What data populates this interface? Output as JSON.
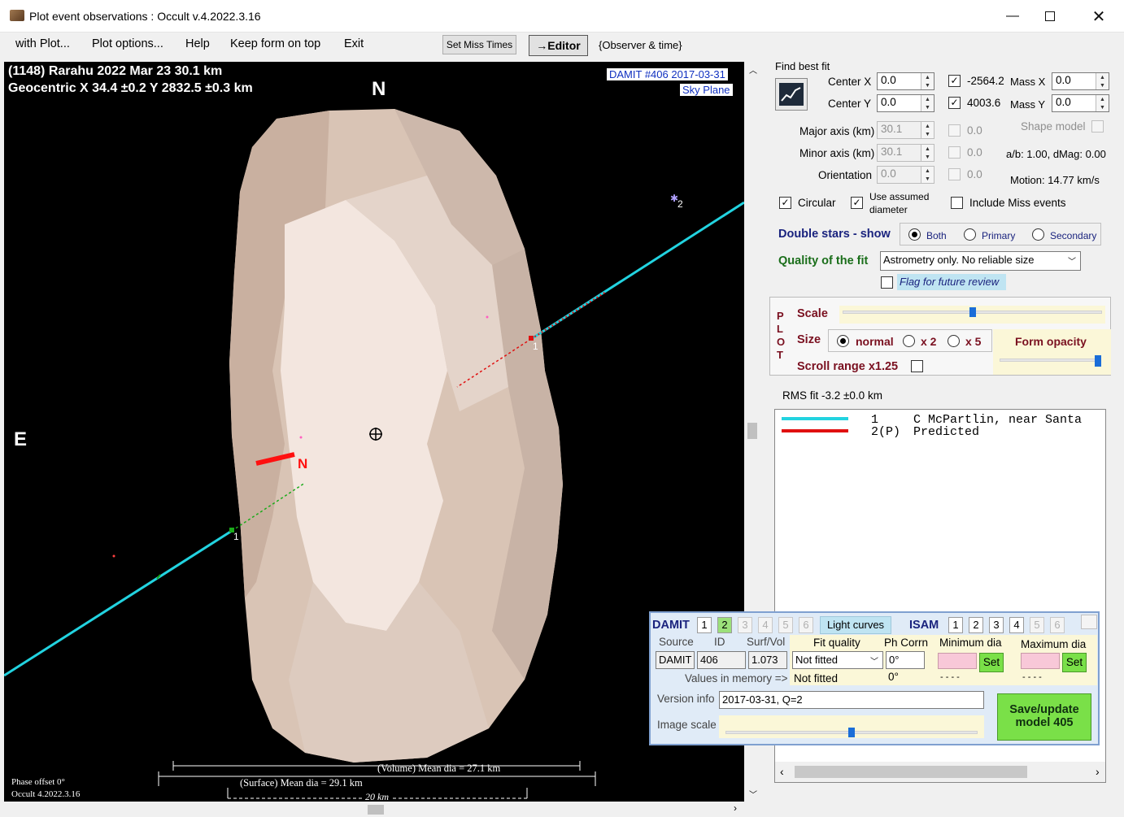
{
  "window": {
    "title": "Plot event observations : Occult v.4.2022.3.16"
  },
  "menu": {
    "items": [
      "with Plot...",
      "Plot options...",
      "Help",
      "Keep form on top",
      "Exit"
    ],
    "set_miss_times": "Set Miss Times",
    "editor": "→Editor",
    "observer_time": "{Observer & time}"
  },
  "plot": {
    "header_line1": "(1148) Rarahu  2022 Mar 23   30.1 km",
    "header_line2": "Geocentric  X  34.4 ±0.2  Y 2832.5 ±0.3 km",
    "north_label": "N",
    "east_label": "E",
    "damit_label": "DAMIT #406 2017-03-31",
    "sky_plane": "Sky Plane",
    "pole_label": "N",
    "chord1_label_a": "1",
    "chord1_label_b": "1",
    "chord2_label": "2",
    "volume_dia": "(Volume) Mean dia = 27.1 km",
    "surface_dia": "(Surface) Mean dia = 29.1 km",
    "scale_label": "20 km",
    "phase_offset": "Phase offset 0°",
    "version": "Occult 4.2022.3.16"
  },
  "fit": {
    "find_best_fit": "Find best fit",
    "center_x_label": "Center X",
    "center_x": "0.0",
    "center_y_label": "Center Y",
    "center_y": "0.0",
    "x_value": "-2564.2",
    "y_value": "4003.6",
    "mass_x_label": "Mass X",
    "mass_x": "0.0",
    "mass_y_label": "Mass Y",
    "mass_y": "0.0",
    "major_axis_label": "Major axis (km)",
    "major_axis": "30.1",
    "major_extra": "0.0",
    "minor_axis_label": "Minor axis (km)",
    "minor_axis": "30.1",
    "minor_extra": "0.0",
    "orientation_label": "Orientation",
    "orientation": "0.0",
    "orientation_extra": "0.0",
    "shape_model": "Shape model",
    "ab_dmag": "a/b: 1.00, dMag: 0.00",
    "motion": "Motion: 14.77 km/s",
    "circular": "Circular",
    "use_assumed_1": "Use assumed",
    "use_assumed_2": "diameter",
    "include_miss": "Include Miss events"
  },
  "double_stars": {
    "label": "Double stars - show",
    "options": [
      "Both",
      "Primary",
      "Secondary"
    ],
    "selected": "Both"
  },
  "quality": {
    "label": "Quality of the fit",
    "value": "Astrometry only. No reliable size",
    "flag": "Flag for future review"
  },
  "plot_controls": {
    "side_letters": [
      "P",
      "L",
      "O",
      "T"
    ],
    "scale": "Scale",
    "size": "Size",
    "size_options": [
      "normal",
      "x 2",
      "x 5"
    ],
    "size_selected": "normal",
    "form_opacity": "Form opacity",
    "scroll_range": "Scroll range x1.25",
    "scale_level": 0.5,
    "opacity_level": 0.97
  },
  "rms": "RMS fit -3.2 ±0.0 km",
  "legend": [
    {
      "num": "1",
      "name": "C McPartlin, near Santa",
      "color": "#22d3e0"
    },
    {
      "num": "2(P)",
      "name": "Predicted",
      "color": "#e01010"
    }
  ],
  "damit": {
    "damit_label": "DAMIT",
    "damit_nums": [
      "1",
      "2",
      "3",
      "4",
      "5",
      "6"
    ],
    "light_curves": "Light curves",
    "isam_label": "ISAM",
    "isam_nums": [
      "1",
      "2",
      "3",
      "4",
      "5",
      "6"
    ],
    "source_label": "Source",
    "source": "DAMIT",
    "id_label": "ID",
    "id": "406",
    "surf_vol_label": "Surf/Vol",
    "surf_vol": "1.073",
    "fit_quality_label": "Fit quality",
    "fit_quality": "Not fitted",
    "ph_corr_label": "Ph Corrn",
    "ph_corr": "0°",
    "min_dia_label": "Minimum dia",
    "max_dia_label": "Maximum dia",
    "set": "Set",
    "values_in_memory": "Values in memory =>",
    "mem_fit": "Not fitted",
    "mem_ph": "0°",
    "mem_min": "- - - -",
    "mem_max": "- - - -",
    "version_info_label": "Version info",
    "version_info": "2017-03-31, Q=2",
    "image_scale_label": "Image scale",
    "image_scale_level": 0.5,
    "save_update_1": "Save/update",
    "save_update_2": "model 405"
  }
}
